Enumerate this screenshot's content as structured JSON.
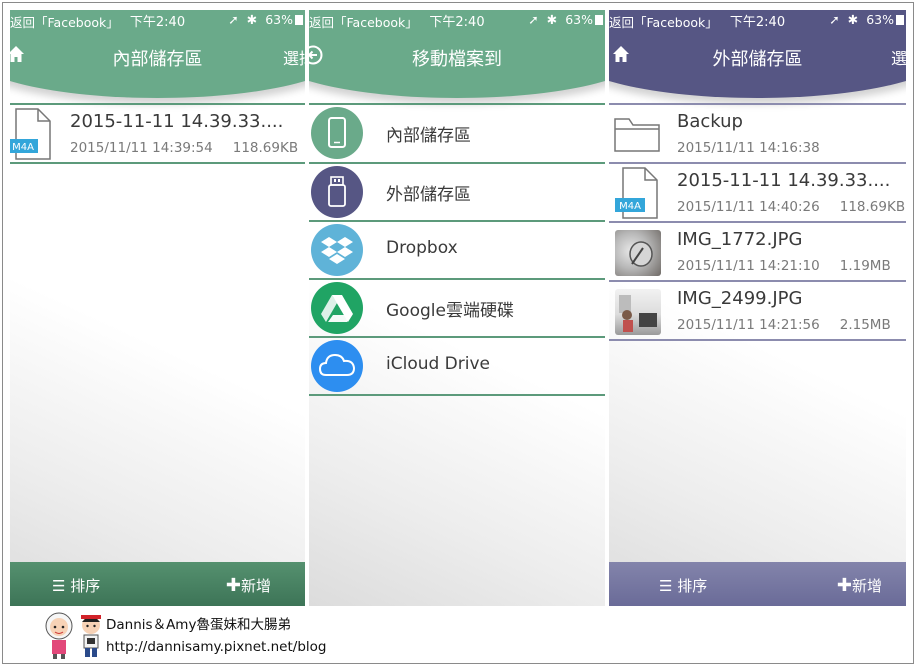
{
  "status": {
    "back": "返回「Facebook」",
    "time": "下午2:40",
    "battery": "63%"
  },
  "left": {
    "title": "內部儲存區",
    "select_label": "選擇",
    "files": [
      {
        "name": "2015-11-11 14.39.33....",
        "date": "2015/11/11 14:39:54",
        "size": "118.69KB",
        "badge": "M4A"
      }
    ],
    "sort_label": "排序",
    "add_label": "新增"
  },
  "middle": {
    "title": "移動檔案到",
    "destinations": [
      {
        "label": "內部儲存區",
        "icon": "phone-icon",
        "color": "#6aaa8a"
      },
      {
        "label": "外部儲存區",
        "icon": "usb-drive-icon",
        "color": "#565684"
      },
      {
        "label": "Dropbox",
        "icon": "dropbox-icon",
        "color": "#5fb3d8"
      },
      {
        "label": "Google雲端硬碟",
        "icon": "google-drive-icon",
        "color": "#20a464"
      },
      {
        "label": "iCloud Drive",
        "icon": "cloud-icon",
        "color": "#2d8ef0"
      }
    ]
  },
  "right": {
    "title": "外部儲存區",
    "select_label": "選擇",
    "files": [
      {
        "name": "Backup",
        "date": "2015/11/11 14:16:38",
        "size": "",
        "type": "folder"
      },
      {
        "name": "2015-11-11 14.39.33....",
        "date": "2015/11/11 14:40:26",
        "size": "118.69KB",
        "type": "audio",
        "badge": "M4A"
      },
      {
        "name": "IMG_1772.JPG",
        "date": "2015/11/11 14:21:10",
        "size": "1.19MB",
        "type": "image"
      },
      {
        "name": "IMG_2499.JPG",
        "date": "2015/11/11 14:21:56",
        "size": "2.15MB",
        "type": "image"
      }
    ],
    "sort_label": "排序",
    "add_label": "新增"
  },
  "watermark": {
    "name": "Dannis＆Amy魯蛋妹和大腸弟",
    "url": "http://dannisamy.pixnet.net/blog"
  }
}
